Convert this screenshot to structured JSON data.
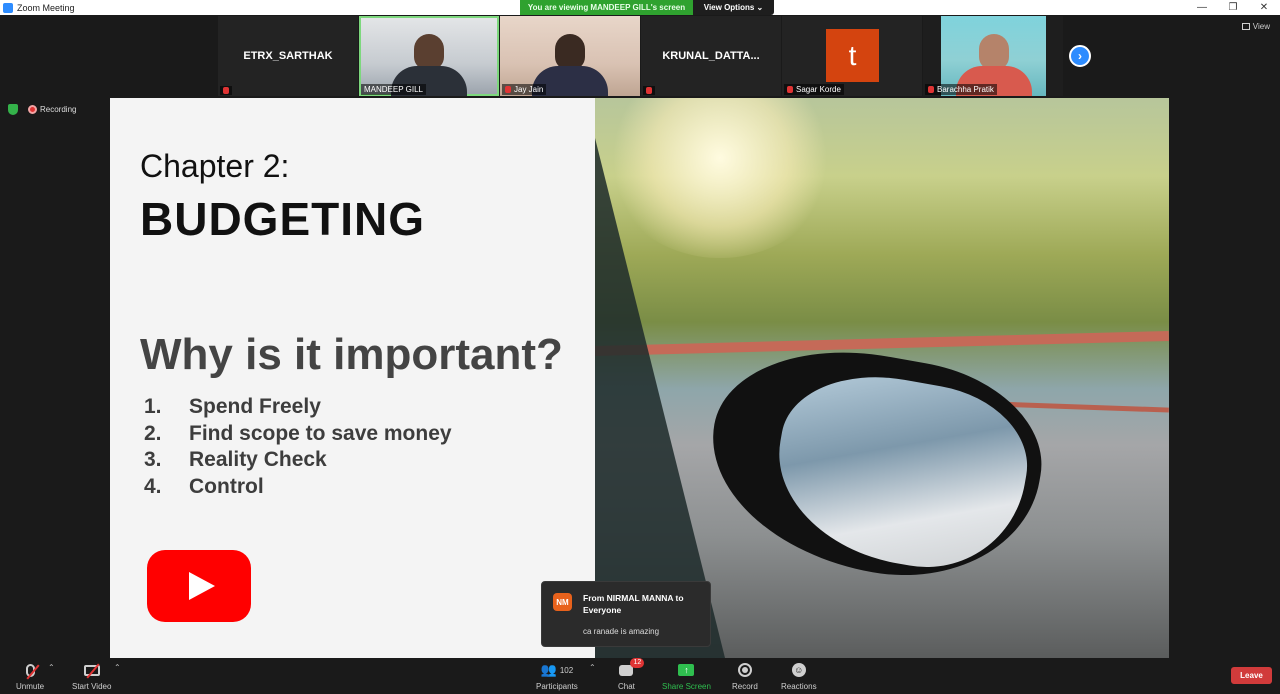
{
  "window": {
    "title": "Zoom Meeting",
    "minimize": "—",
    "restore": "❐",
    "close": "✕"
  },
  "banner": {
    "viewing_text": "You are viewing MANDEEP GILL's screen",
    "view_options": "View Options ⌄"
  },
  "view_toggle": {
    "label": "View"
  },
  "participants_strip": [
    {
      "name": "ETRX_SARTHAK",
      "video": false,
      "muted": true
    },
    {
      "name": "MANDEEP GILL",
      "video": true,
      "muted": false,
      "active": true
    },
    {
      "name": "Jay Jain",
      "video": true,
      "muted": true
    },
    {
      "name": "KRUNAL_DATTA...",
      "video": false,
      "muted": true
    },
    {
      "name": "Sagar Korde",
      "video": false,
      "avatar_letter": "t",
      "avatar_color": "#d4440f",
      "muted": true
    },
    {
      "name": "Barachha Pratik",
      "video": true,
      "muted": true
    }
  ],
  "next_arrow": "›",
  "status": {
    "recording_label": "Recording"
  },
  "slide": {
    "chapter": "Chapter 2:",
    "heading": "BUDGETING",
    "question": "Why is it important?",
    "points": [
      {
        "num": "1.",
        "text": "Spend Freely"
      },
      {
        "num": "2.",
        "text": "Find scope to save money"
      },
      {
        "num": "3.",
        "text": "Reality Check"
      },
      {
        "num": "4.",
        "text": "Control"
      }
    ]
  },
  "chat_toast": {
    "initials": "NM",
    "from": "From NIRMAL MANNA to Everyone",
    "message": "ca ranade is amazing"
  },
  "toolbar": {
    "unmute": "Unmute",
    "start_video": "Start Video",
    "participants": "Participants",
    "participants_count": "102",
    "chat": "Chat",
    "chat_badge": "12",
    "share_screen": "Share Screen",
    "record": "Record",
    "reactions": "Reactions",
    "leave": "Leave"
  },
  "colors": {
    "share_green": "#2fbf4f",
    "leave_red": "#d13b3b",
    "accent_blue": "#2d8cff",
    "youtube_red": "#ff0000"
  }
}
